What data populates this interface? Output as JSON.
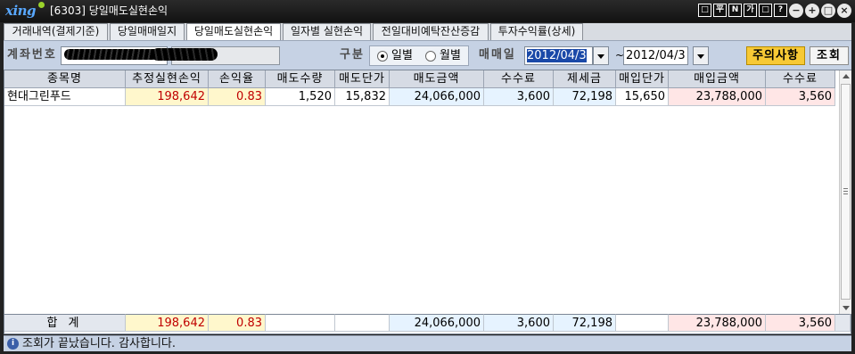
{
  "window": {
    "logo": "xing",
    "title": "[6303] 당일매도실현손익",
    "title_buttons": [
      "□",
      "平",
      "N",
      "가",
      "□",
      "?"
    ],
    "round_buttons": [
      "−",
      "+",
      "□",
      "×"
    ]
  },
  "tabs": [
    {
      "label": "거래내역(결제기준)",
      "active": false
    },
    {
      "label": "당일매매일지",
      "active": false
    },
    {
      "label": "당일매도실현손익",
      "active": true
    },
    {
      "label": "일자별 실현손익",
      "active": false
    },
    {
      "label": "전일대비예탁잔산증감",
      "active": false
    },
    {
      "label": "투자수익률(상세)",
      "active": false
    }
  ],
  "query": {
    "account_label": "계좌번호",
    "type_label": "구분",
    "radio_daily": "일별",
    "radio_monthly": "월별",
    "selected_period": "daily",
    "trade_date_label": "매매일",
    "date_from": "2012/04/3",
    "date_to": "2012/04/3",
    "date_separator": "~",
    "notice_button": "주의사항",
    "query_button": "조회"
  },
  "table": {
    "headers": [
      "종목명",
      "추정실현손익",
      "손익율",
      "매도수량",
      "매도단가",
      "매도금액",
      "수수료",
      "제세금",
      "매입단가",
      "매입금액",
      "수수료"
    ],
    "rows": [
      [
        "현대그린푸드",
        "198,642",
        "0.83",
        "1,520",
        "15,832",
        "24,066,000",
        "3,600",
        "72,198",
        "15,650",
        "23,788,000",
        "3,560"
      ]
    ],
    "total": [
      "합 계",
      "198,642",
      "0.83",
      "",
      "",
      "24,066,000",
      "3,600",
      "72,198",
      "",
      "23,788,000",
      "3,560"
    ]
  },
  "status": {
    "message": "조회가 끝났습니다. 감사합니다."
  }
}
